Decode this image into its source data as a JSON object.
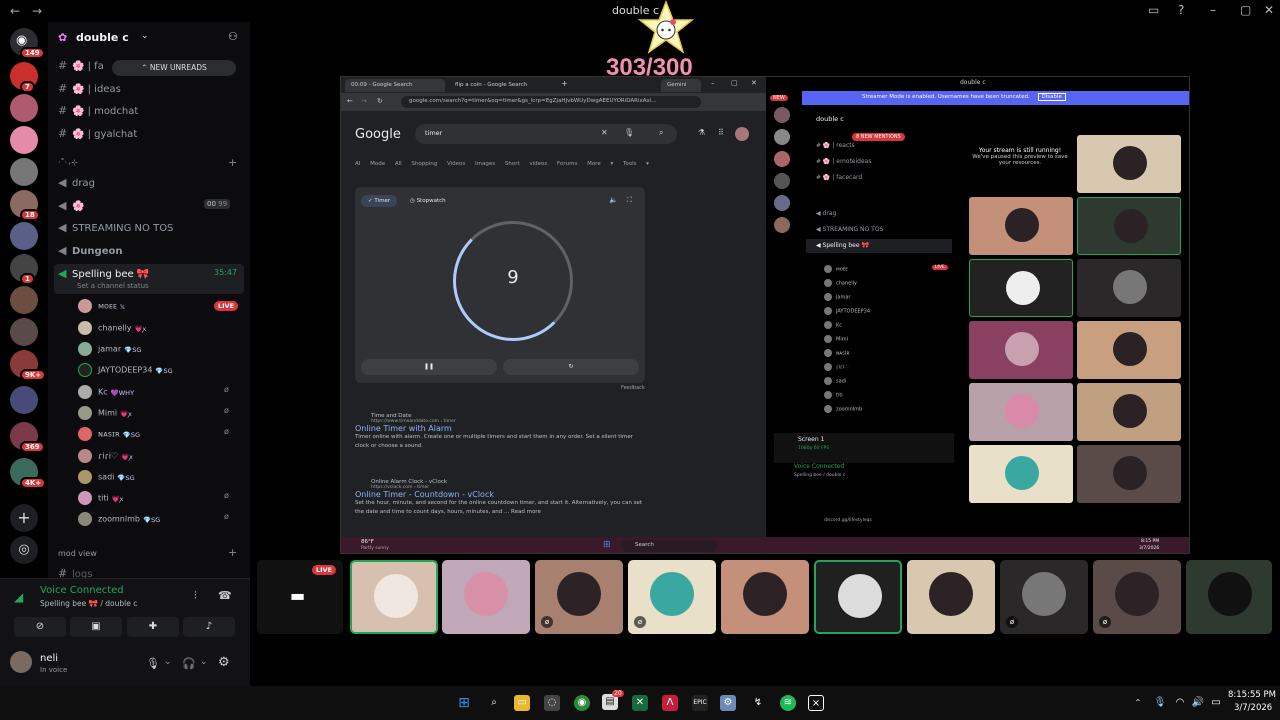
{
  "titlebar": {
    "title": "double c"
  },
  "overlay": {
    "counter": "303/300"
  },
  "rail": {
    "badges": [
      "149",
      "7",
      "18",
      "1",
      "9K+",
      "369",
      "4K+"
    ]
  },
  "sidebar": {
    "server_name": "double c",
    "new_unreads": "NEW UNREADS",
    "channels": [
      {
        "icon": "#",
        "name": "🌸 | fa"
      },
      {
        "icon": "#",
        "name": "🌸 | ideas"
      },
      {
        "icon": "#",
        "name": "🌸 | modchat"
      },
      {
        "icon": "#",
        "name": "🌸 | gyalchat"
      }
    ],
    "category": "·˚‧₊⊹",
    "voice_channels": [
      {
        "name": "drag"
      },
      {
        "name": "🌸",
        "count": "00",
        "max": "99"
      },
      {
        "name": "STREAMING NO TOS"
      },
      {
        "name": "Dungeon"
      }
    ],
    "active_voice": {
      "name": "Spelling bee 🎀",
      "timer": "35:47",
      "status": "Set a channel status"
    },
    "users": [
      {
        "name": "ᴍᴏᴇᴇ",
        "tag": "𝕏",
        "live": "LIVE"
      },
      {
        "name": "chanelly",
        "tag": "💗ꭗ"
      },
      {
        "name": "jamar",
        "tag": "💎SG"
      },
      {
        "name": "JAYTODEEP34",
        "tag": "💎SG"
      },
      {
        "name": "Kc",
        "tag": "💜WHY"
      },
      {
        "name": "Mimi",
        "tag": "💗ꭗ"
      },
      {
        "name": "ɴᴀsɪʀ",
        "tag": "💎SG"
      },
      {
        "name": "ɾiɾi♡",
        "tag": "💗ꭗ"
      },
      {
        "name": "sadi",
        "tag": "💎SG"
      },
      {
        "name": "titi",
        "tag": "💗ꭗ"
      },
      {
        "name": "zoomnlmb",
        "tag": "💎SG"
      }
    ],
    "mod_view": "mod view",
    "logs": "logs"
  },
  "voice_panel": {
    "status": "Voice Connected",
    "location": "Spelling bee 🎀 / double c",
    "user_name": "neli",
    "user_status": "In voice"
  },
  "stream": {
    "browser": {
      "tabs": [
        "00:09 - Google Search",
        "flip a coin - Google Search"
      ],
      "gemini": "Gemini",
      "url": "google.com/search?q=timer&oq=timer&gs_lcrp=EgZjaHJvbWUyDwgAEEUYORiDARixAxi...",
      "logo": "Google",
      "query": "timer",
      "search_tabs": "AI Mode  All  Shopping  Videos  Images  Short videos  Forums  More ▾  Tools ▾",
      "timer_tab": "Timer",
      "stopwatch_tab": "Stopwatch",
      "timer_value": "9",
      "feedback": "Feedback",
      "results": [
        {
          "site": "Time and Date",
          "link": "https://www.timeanddate.com › timer",
          "title": "Online Timer with Alarm",
          "snippet": "Timer online with alarm. Create one or multiple timers and start them in any order. Set a silent timer clock or choose a sound."
        },
        {
          "site": "Online Alarm Clock - vClock",
          "link": "https://vclock.com › timer",
          "title": "Online Timer - Countdown - vClock",
          "snippet": "Set the hour, minute, and second for the online countdown timer, and start it. Alternatively, you can set the date and time to count days, hours, minutes, and ...  Read more"
        }
      ],
      "weather": "86°F",
      "weather_desc": "Partly sunny",
      "taskbar_search": "Search",
      "clock_time": "8:15 PM",
      "clock_date": "3/7/2026"
    },
    "inner_discord": {
      "title": "double c",
      "streamer_notice": "Streamer Mode is enabled. Usernames have been truncated.",
      "disable": "Disable",
      "server": "double c",
      "mentions": "8 NEW MENTIONS",
      "channels": [
        "reacts",
        "emoteideas",
        "facecard"
      ],
      "voice": [
        "drag",
        "STREAMING NO TOS"
      ],
      "spelling_bee": "Spelling bee 🎀",
      "still_running": "Your stream is still running!",
      "still_running_sub": "We've paused this preview to save your resources.",
      "screen": "Screen 1",
      "screen_sub": "1080p 60 FPS",
      "vc": "Voice Connected",
      "vc_sub": "Spelling bee / double c",
      "invite": "discord.gg/lifestyleqs",
      "new_label": "NEW",
      "live_label": "LIVE"
    }
  },
  "strip": {
    "live": "LIVE"
  },
  "taskbar": {
    "time": "8:15:55 PM",
    "date": "3/7/2026",
    "notif_count": "20"
  },
  "colors": {
    "discord_bg": "#0c0c0e",
    "live_red": "#da373c",
    "voice_green": "#23a55a",
    "blurple": "#5865f2",
    "counter_pink": "#f48fb1"
  }
}
